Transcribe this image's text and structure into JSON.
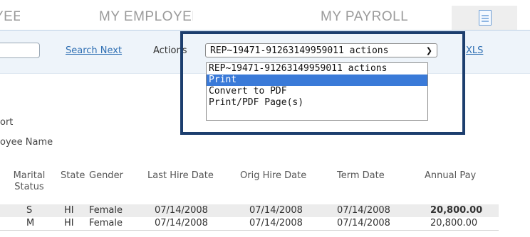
{
  "nav": {
    "items": [
      {
        "label": "MY EMPLOYEES"
      },
      {
        "label": "MY EMPLOYEES"
      },
      {
        "label": "MY PAYROLLS"
      }
    ],
    "doc_icon": "document-icon"
  },
  "toolbar": {
    "search_next": "Search Next",
    "actions_label": "Actions",
    "select_value": "REP~19471-91263149959011 actions",
    "select_chevron": "chevron-down-icon",
    "xls": "XLS"
  },
  "dropdown": {
    "options": [
      {
        "label": "REP~19471-91263149959011 actions",
        "selected": false
      },
      {
        "label": "Print",
        "selected": true
      },
      {
        "label": "Convert to PDF",
        "selected": false
      },
      {
        "label": "Print/PDF Page(s)",
        "selected": false
      }
    ]
  },
  "report": {
    "line1": "ort",
    "line2": "oyee Name"
  },
  "table": {
    "headers": [
      "Marital Status",
      "State",
      "Gender",
      "Last Hire Date",
      "Orig Hire Date",
      "Term Date",
      "Annual Pay"
    ],
    "rows": [
      [
        "S",
        "HI",
        "Female",
        "07/14/2008",
        "07/14/2008",
        "07/14/2008",
        "20,800.00"
      ],
      [
        "M",
        "HI",
        "Female",
        "07/14/2008",
        "07/14/2008",
        "07/14/2008",
        "20,800.00"
      ]
    ]
  },
  "colors": {
    "accent_blue": "#3a7ad8",
    "highlight_border": "#1c3e6e",
    "link": "#2f6fb3"
  }
}
